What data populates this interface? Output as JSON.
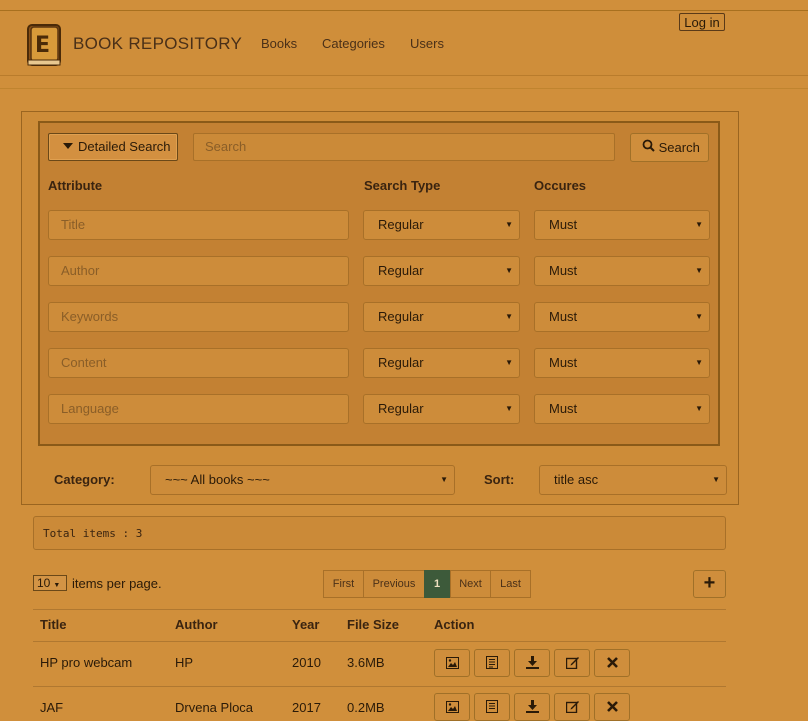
{
  "header": {
    "brand": "BOOK REPOSITORY",
    "nav": [
      "Books",
      "Categories",
      "Users"
    ],
    "login_label": "Log in"
  },
  "search": {
    "detailed_label": "Detailed Search",
    "placeholder": "Search",
    "button_label": "Search",
    "headers": {
      "attribute": "Attribute",
      "search_type": "Search Type",
      "occures": "Occures"
    },
    "rows": [
      {
        "attribute": "Title",
        "type": "Regular",
        "occures": "Must"
      },
      {
        "attribute": "Author",
        "type": "Regular",
        "occures": "Must"
      },
      {
        "attribute": "Keywords",
        "type": "Regular",
        "occures": "Must"
      },
      {
        "attribute": "Content",
        "type": "Regular",
        "occures": "Must"
      },
      {
        "attribute": "Language",
        "type": "Regular",
        "occures": "Must"
      }
    ]
  },
  "filters": {
    "category_label": "Category:",
    "category_value": "~~~ All books ~~~",
    "sort_label": "Sort:",
    "sort_value": "title asc"
  },
  "results": {
    "total_text": "Total items : 3",
    "per_page_value": "10",
    "per_page_label": "items per page.",
    "pagination": [
      "First",
      "Previous",
      "1",
      "Next",
      "Last"
    ],
    "active_page": "1"
  },
  "table": {
    "headers": [
      "Title",
      "Author",
      "Year",
      "File Size",
      "Action"
    ],
    "rows": [
      {
        "title": "HP pro webcam",
        "author": "HP",
        "year": "2010",
        "size": "3.6MB"
      },
      {
        "title": "JAF",
        "author": "Drvena Ploca",
        "year": "2017",
        "size": "0.2MB"
      }
    ]
  },
  "icons": [
    "book-logo-icon",
    "caret-down-icon",
    "search-icon",
    "plus-icon",
    "image-icon",
    "document-icon",
    "download-icon",
    "edit-icon",
    "delete-icon"
  ],
  "colors": {
    "background": "#d08f3b",
    "active_page": "#3d5a3a"
  }
}
